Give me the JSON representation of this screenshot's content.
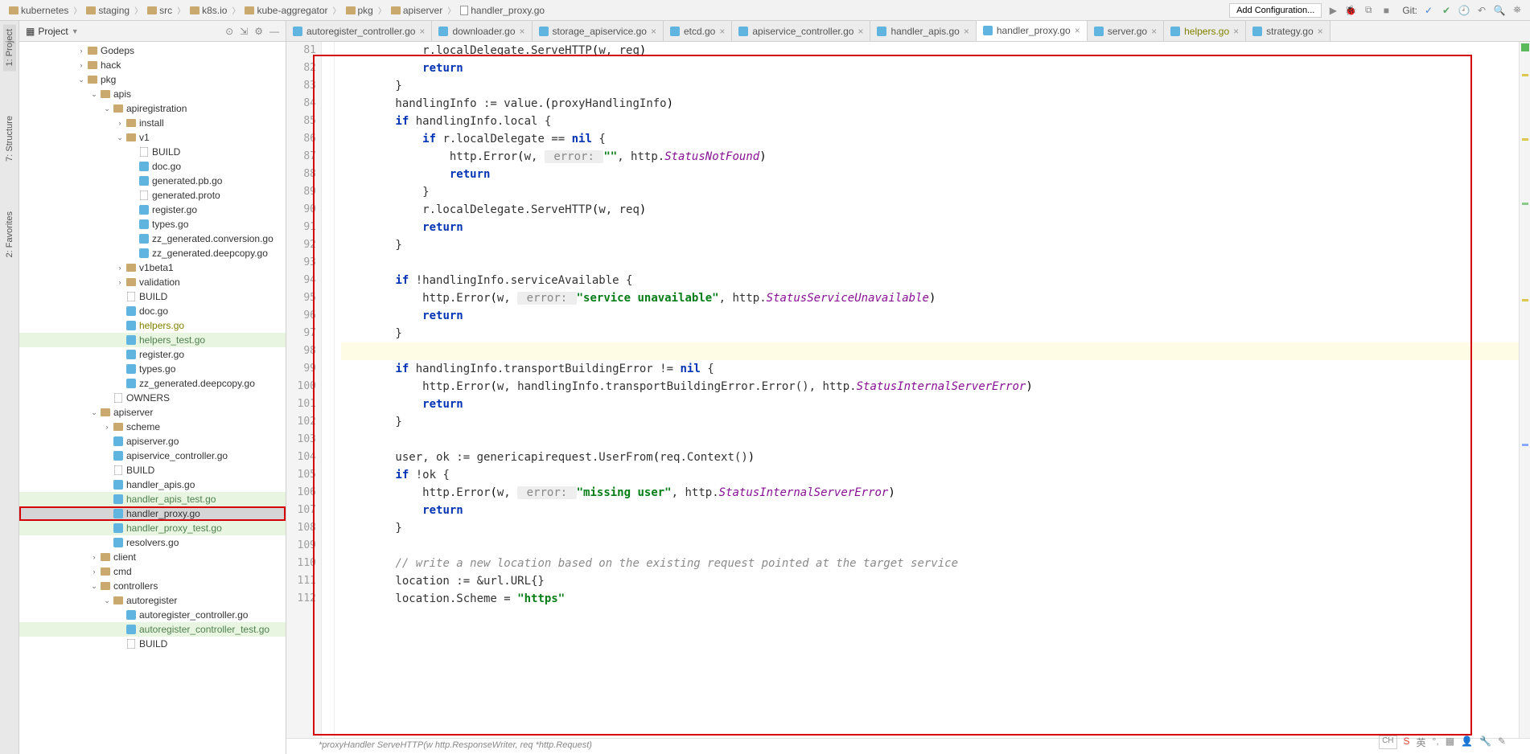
{
  "breadcrumbs": [
    "kubernetes",
    "staging",
    "src",
    "k8s.io",
    "kube-aggregator",
    "pkg",
    "apiserver",
    "handler_proxy.go"
  ],
  "toolbar": {
    "add_conf": "Add Configuration...",
    "git_label": "Git:"
  },
  "gutter_left": [
    "1: Project",
    "7: Structure",
    "2: Favorites"
  ],
  "project_header": "Project",
  "tree": [
    {
      "depth": 0,
      "arrow": "›",
      "icon": "folder",
      "label": "Godeps"
    },
    {
      "depth": 0,
      "arrow": "›",
      "icon": "folder",
      "label": "hack"
    },
    {
      "depth": 0,
      "arrow": "⌄",
      "icon": "folder",
      "label": "pkg"
    },
    {
      "depth": 1,
      "arrow": "⌄",
      "icon": "folder",
      "label": "apis"
    },
    {
      "depth": 2,
      "arrow": "⌄",
      "icon": "folder",
      "label": "apiregistration"
    },
    {
      "depth": 3,
      "arrow": "›",
      "icon": "folder",
      "label": "install"
    },
    {
      "depth": 3,
      "arrow": "⌄",
      "icon": "folder",
      "label": "v1"
    },
    {
      "depth": 4,
      "arrow": "",
      "icon": "file",
      "label": "BUILD"
    },
    {
      "depth": 4,
      "arrow": "",
      "icon": "go",
      "label": "doc.go"
    },
    {
      "depth": 4,
      "arrow": "",
      "icon": "go",
      "label": "generated.pb.go"
    },
    {
      "depth": 4,
      "arrow": "",
      "icon": "file",
      "label": "generated.proto"
    },
    {
      "depth": 4,
      "arrow": "",
      "icon": "go",
      "label": "register.go"
    },
    {
      "depth": 4,
      "arrow": "",
      "icon": "go",
      "label": "types.go"
    },
    {
      "depth": 4,
      "arrow": "",
      "icon": "go",
      "label": "zz_generated.conversion.go"
    },
    {
      "depth": 4,
      "arrow": "",
      "icon": "go",
      "label": "zz_generated.deepcopy.go"
    },
    {
      "depth": 3,
      "arrow": "›",
      "icon": "folder",
      "label": "v1beta1"
    },
    {
      "depth": 3,
      "arrow": "›",
      "icon": "folder",
      "label": "validation"
    },
    {
      "depth": 3,
      "arrow": "",
      "icon": "file",
      "label": "BUILD"
    },
    {
      "depth": 3,
      "arrow": "",
      "icon": "go",
      "label": "doc.go"
    },
    {
      "depth": 3,
      "arrow": "",
      "icon": "go",
      "label": "helpers.go",
      "cls": "olive"
    },
    {
      "depth": 3,
      "arrow": "",
      "icon": "go",
      "label": "helpers_test.go",
      "cls": "green",
      "row": "hl-green"
    },
    {
      "depth": 3,
      "arrow": "",
      "icon": "go",
      "label": "register.go"
    },
    {
      "depth": 3,
      "arrow": "",
      "icon": "go",
      "label": "types.go"
    },
    {
      "depth": 3,
      "arrow": "",
      "icon": "go",
      "label": "zz_generated.deepcopy.go"
    },
    {
      "depth": 2,
      "arrow": "",
      "icon": "file",
      "label": "OWNERS"
    },
    {
      "depth": 1,
      "arrow": "⌄",
      "icon": "folder",
      "label": "apiserver"
    },
    {
      "depth": 2,
      "arrow": "›",
      "icon": "folder",
      "label": "scheme"
    },
    {
      "depth": 2,
      "arrow": "",
      "icon": "go",
      "label": "apiserver.go"
    },
    {
      "depth": 2,
      "arrow": "",
      "icon": "go",
      "label": "apiservice_controller.go"
    },
    {
      "depth": 2,
      "arrow": "",
      "icon": "file",
      "label": "BUILD"
    },
    {
      "depth": 2,
      "arrow": "",
      "icon": "go",
      "label": "handler_apis.go"
    },
    {
      "depth": 2,
      "arrow": "",
      "icon": "go",
      "label": "handler_apis_test.go",
      "cls": "green",
      "row": "hl-green"
    },
    {
      "depth": 2,
      "arrow": "",
      "icon": "go",
      "label": "handler_proxy.go",
      "row": "selected"
    },
    {
      "depth": 2,
      "arrow": "",
      "icon": "go",
      "label": "handler_proxy_test.go",
      "cls": "green",
      "row": "hl-green"
    },
    {
      "depth": 2,
      "arrow": "",
      "icon": "go",
      "label": "resolvers.go"
    },
    {
      "depth": 1,
      "arrow": "›",
      "icon": "folder",
      "label": "client"
    },
    {
      "depth": 1,
      "arrow": "›",
      "icon": "folder",
      "label": "cmd"
    },
    {
      "depth": 1,
      "arrow": "⌄",
      "icon": "folder",
      "label": "controllers"
    },
    {
      "depth": 2,
      "arrow": "⌄",
      "icon": "folder",
      "label": "autoregister"
    },
    {
      "depth": 3,
      "arrow": "",
      "icon": "go",
      "label": "autoregister_controller.go"
    },
    {
      "depth": 3,
      "arrow": "",
      "icon": "go",
      "label": "autoregister_controller_test.go",
      "cls": "green",
      "row": "hl-green"
    },
    {
      "depth": 3,
      "arrow": "",
      "icon": "file",
      "label": "BUILD"
    }
  ],
  "tabs": [
    {
      "label": "autoregister_controller.go"
    },
    {
      "label": "downloader.go"
    },
    {
      "label": "storage_apiservice.go"
    },
    {
      "label": "etcd.go"
    },
    {
      "label": "apiservice_controller.go"
    },
    {
      "label": "handler_apis.go"
    },
    {
      "label": "handler_proxy.go",
      "active": true
    },
    {
      "label": "server.go"
    },
    {
      "label": "helpers.go",
      "cls": "olive"
    },
    {
      "label": "strategy.go"
    }
  ],
  "line_start": 81,
  "line_end": 112,
  "cursor_line": 98,
  "code": {
    "l81": {
      "indent": 3,
      "tokens": [
        {
          "t": "r.localDelegate.ServeHTTP"
        },
        {
          "t": "(",
          "c": "paren"
        },
        {
          "t": "w"
        },
        {
          "t": ", req"
        },
        {
          "t": ")",
          "c": "paren"
        }
      ]
    },
    "l82": {
      "indent": 3,
      "tokens": [
        {
          "t": "return",
          "c": "kw"
        }
      ]
    },
    "l83": {
      "indent": 2,
      "tokens": [
        {
          "t": "}"
        }
      ]
    },
    "l84": {
      "indent": 2,
      "tokens": [
        {
          "t": "handlingInfo := value."
        },
        {
          "t": "(",
          "c": "paren"
        },
        {
          "t": "proxyHandlingInfo"
        },
        {
          "t": ")",
          "c": "paren"
        }
      ]
    },
    "l85": {
      "indent": 2,
      "tokens": [
        {
          "t": "if ",
          "c": "kw"
        },
        {
          "t": "handlingInfo.local {"
        }
      ]
    },
    "l86": {
      "indent": 3,
      "tokens": [
        {
          "t": "if ",
          "c": "kw"
        },
        {
          "t": "r.localDelegate == "
        },
        {
          "t": "nil ",
          "c": "kw"
        },
        {
          "t": "{"
        }
      ]
    },
    "l87": {
      "indent": 4,
      "tokens": [
        {
          "t": "http.Error"
        },
        {
          "t": "(",
          "c": "paren"
        },
        {
          "t": "w, "
        },
        {
          "t": " error: ",
          "c": "hint"
        },
        {
          "t": "\"\"",
          "c": "str"
        },
        {
          "t": ", http."
        },
        {
          "t": "StatusNotFound",
          "c": "purple"
        },
        {
          "t": ")",
          "c": "paren"
        }
      ]
    },
    "l88": {
      "indent": 4,
      "tokens": [
        {
          "t": "return",
          "c": "kw"
        }
      ]
    },
    "l89": {
      "indent": 3,
      "tokens": [
        {
          "t": "}"
        }
      ]
    },
    "l90": {
      "indent": 3,
      "tokens": [
        {
          "t": "r.localDelegate.ServeHTTP"
        },
        {
          "t": "(",
          "c": "paren"
        },
        {
          "t": "w, req"
        },
        {
          "t": ")",
          "c": "paren"
        }
      ]
    },
    "l91": {
      "indent": 3,
      "tokens": [
        {
          "t": "return",
          "c": "kw"
        }
      ]
    },
    "l92": {
      "indent": 2,
      "tokens": [
        {
          "t": "}"
        }
      ]
    },
    "l93": {
      "indent": 0,
      "tokens": []
    },
    "l94": {
      "indent": 2,
      "tokens": [
        {
          "t": "if ",
          "c": "kw"
        },
        {
          "t": "!handlingInfo.serviceAvailable {"
        }
      ]
    },
    "l95": {
      "indent": 3,
      "tokens": [
        {
          "t": "http.Error"
        },
        {
          "t": "(",
          "c": "paren"
        },
        {
          "t": "w, "
        },
        {
          "t": " error: ",
          "c": "hint"
        },
        {
          "t": "\"service unavailable\"",
          "c": "str"
        },
        {
          "t": ", http."
        },
        {
          "t": "StatusServiceUnavailable",
          "c": "purple"
        },
        {
          "t": ")",
          "c": "paren"
        }
      ]
    },
    "l96": {
      "indent": 3,
      "tokens": [
        {
          "t": "return",
          "c": "kw"
        }
      ]
    },
    "l97": {
      "indent": 2,
      "tokens": [
        {
          "t": "}"
        }
      ]
    },
    "l98": {
      "indent": 0,
      "tokens": []
    },
    "l99": {
      "indent": 2,
      "tokens": [
        {
          "t": "if ",
          "c": "kw"
        },
        {
          "t": "handlingInfo.transportBuildingError != "
        },
        {
          "t": "nil ",
          "c": "kw"
        },
        {
          "t": "{"
        }
      ]
    },
    "l100": {
      "indent": 3,
      "tokens": [
        {
          "t": "http.Error"
        },
        {
          "t": "(",
          "c": "paren"
        },
        {
          "t": "w, handlingInfo.transportBuildingError.Error(), http."
        },
        {
          "t": "StatusInternalServerError",
          "c": "purple"
        },
        {
          "t": ")",
          "c": "paren"
        }
      ]
    },
    "l101": {
      "indent": 3,
      "tokens": [
        {
          "t": "return",
          "c": "kw"
        }
      ]
    },
    "l102": {
      "indent": 2,
      "tokens": [
        {
          "t": "}"
        }
      ]
    },
    "l103": {
      "indent": 0,
      "tokens": []
    },
    "l104": {
      "indent": 2,
      "tokens": [
        {
          "t": "user, ok := genericapirequest.UserFrom"
        },
        {
          "t": "(",
          "c": "paren"
        },
        {
          "t": "req.Context()"
        },
        {
          "t": ")",
          "c": "paren"
        }
      ]
    },
    "l105": {
      "indent": 2,
      "tokens": [
        {
          "t": "if ",
          "c": "kw"
        },
        {
          "t": "!ok {"
        }
      ]
    },
    "l106": {
      "indent": 3,
      "tokens": [
        {
          "t": "http.Error"
        },
        {
          "t": "(",
          "c": "paren"
        },
        {
          "t": "w, "
        },
        {
          "t": " error: ",
          "c": "hint"
        },
        {
          "t": "\"missing user\"",
          "c": "str"
        },
        {
          "t": ", http."
        },
        {
          "t": "StatusInternalServerError",
          "c": "purple"
        },
        {
          "t": ")",
          "c": "paren"
        }
      ]
    },
    "l107": {
      "indent": 3,
      "tokens": [
        {
          "t": "return",
          "c": "kw"
        }
      ]
    },
    "l108": {
      "indent": 2,
      "tokens": [
        {
          "t": "}"
        }
      ]
    },
    "l109": {
      "indent": 0,
      "tokens": []
    },
    "l110": {
      "indent": 2,
      "tokens": [
        {
          "t": "// write a new location based on the existing request pointed at the target service",
          "c": "comment"
        }
      ]
    },
    "l111": {
      "indent": 2,
      "tokens": [
        {
          "t": "location := &url.URL{}"
        }
      ]
    },
    "l112": {
      "indent": 2,
      "tokens": [
        {
          "t": "location.Scheme = "
        },
        {
          "t": "\"https\"",
          "c": "str"
        }
      ]
    }
  },
  "bottom_crumb": "*proxyHandler ServeHTTP(w http.ResponseWriter, req *http.Request)",
  "status_right": {
    "ch": "CH"
  }
}
